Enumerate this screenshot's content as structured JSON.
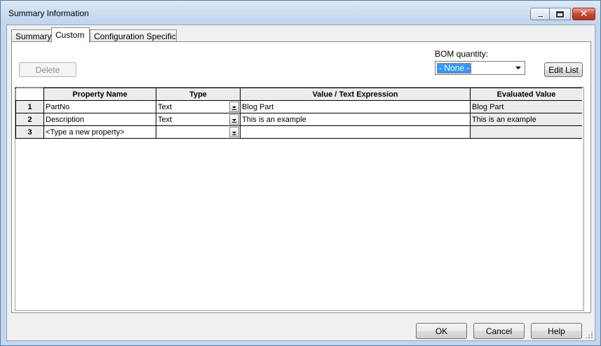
{
  "window": {
    "title": "Summary Information"
  },
  "tabs": [
    {
      "label": "Summary",
      "active": false
    },
    {
      "label": "Custom",
      "active": true
    },
    {
      "label": "Configuration Specific",
      "active": false
    }
  ],
  "toolbar": {
    "delete_label": "Delete",
    "bom_label": "BOM quantity:",
    "bom_value": "- None -",
    "edit_list_label": "Edit List"
  },
  "grid": {
    "columns": [
      "Property Name",
      "Type",
      "Value / Text Expression",
      "Evaluated Value"
    ],
    "rows": [
      {
        "num": "1",
        "name": "PartNo",
        "type": "Text",
        "value": "Blog Part",
        "evaluated": "Blog Part"
      },
      {
        "num": "2",
        "name": "Description",
        "type": "Text",
        "value": "This is an example",
        "evaluated": "This is an example"
      },
      {
        "num": "3",
        "name": "<Type a new property>",
        "type": "",
        "value": "",
        "evaluated": ""
      }
    ]
  },
  "footer": {
    "ok_label": "OK",
    "cancel_label": "Cancel",
    "help_label": "Help"
  },
  "icons": {
    "minimize": "minimize-icon",
    "maximize": "maximize-icon",
    "close": "close-icon",
    "dropdown": "chevron-down-icon"
  }
}
